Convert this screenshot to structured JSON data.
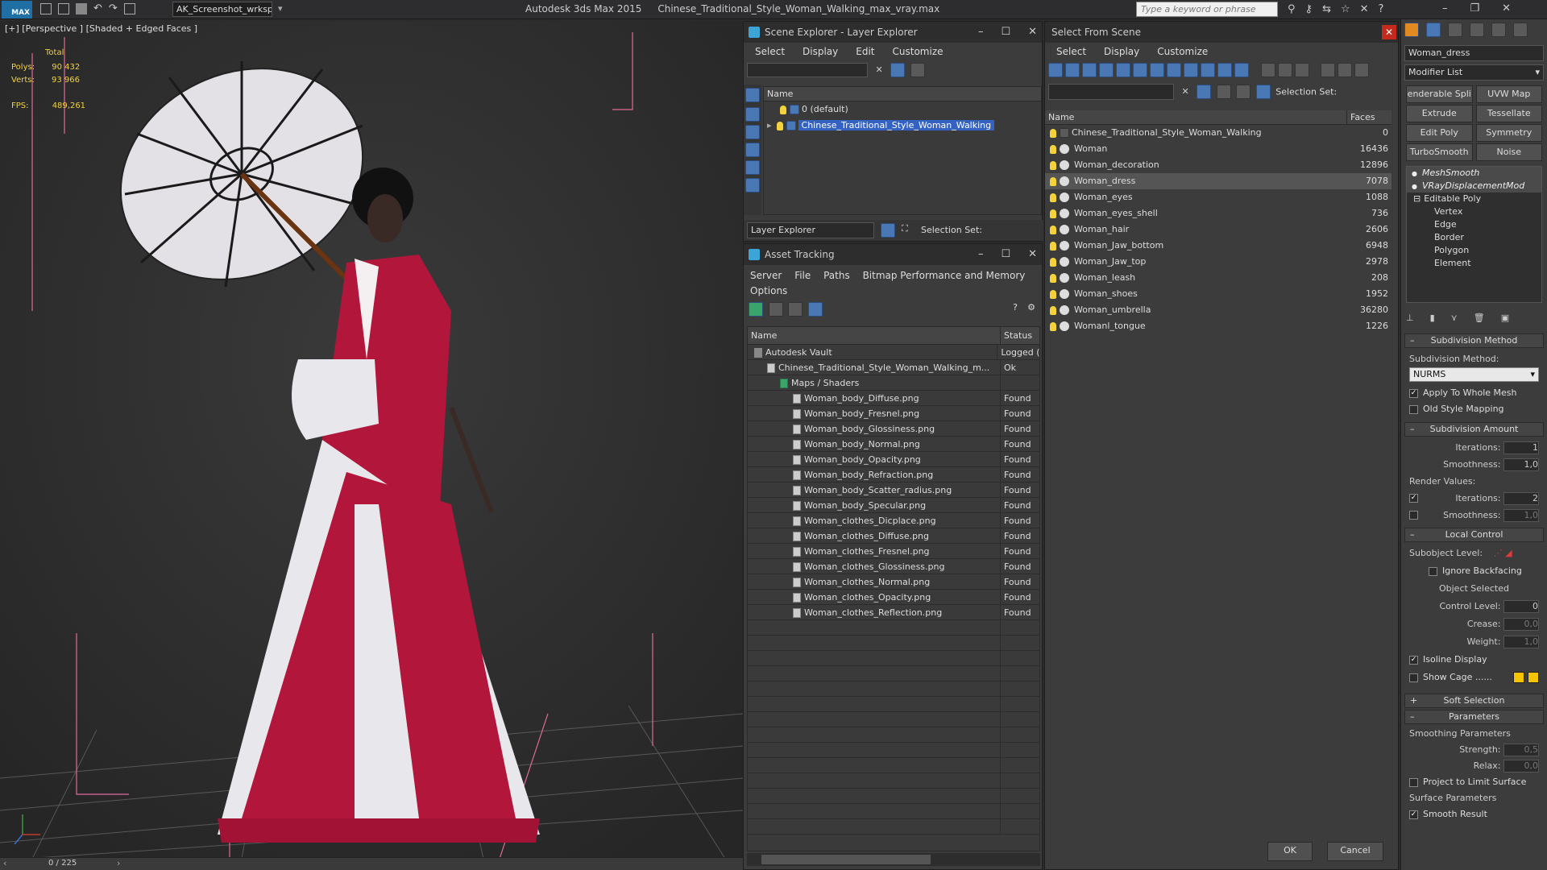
{
  "app": {
    "title": "Autodesk 3ds Max  2015",
    "file": "Chinese_Traditional_Style_Woman_Walking_max_vray.max",
    "workspace": "AK_Screenshot_wrksp",
    "search_placeholder": "Type a keyword or phrase",
    "logo": "MAX"
  },
  "viewport": {
    "label": "[+] [Perspective ] [Shaded + Edged Faces ]",
    "stats": {
      "total_label": "Total",
      "polys_label": "Polys:",
      "polys": "90 432",
      "verts_label": "Verts:",
      "verts": "93 966",
      "fps_label": "FPS:",
      "fps": "489,261"
    },
    "timeline": "0 / 225",
    "colors": {
      "dress_red": "#b2163b",
      "dress_white": "#e8e8ec",
      "grid": "#8a8a8a"
    }
  },
  "scene_explorer": {
    "title": "Scene Explorer - Layer Explorer",
    "menu": [
      "Select",
      "Display",
      "Edit",
      "Customize"
    ],
    "col_name": "Name",
    "layers": [
      {
        "name": "0 (default)"
      },
      {
        "name": "Chinese_Traditional_Style_Woman_Walking",
        "selected": true
      }
    ],
    "footer_dropdown": "Layer Explorer",
    "selection_set": "Selection Set:"
  },
  "asset_tracking": {
    "title": "Asset Tracking",
    "menu": [
      "Server",
      "File",
      "Paths",
      "Bitmap Performance and Memory"
    ],
    "menu2": "Options",
    "col_name": "Name",
    "col_status": "Status",
    "rows": [
      {
        "name": "Autodesk Vault",
        "status": "Logged (",
        "indent": 0
      },
      {
        "name": "Chinese_Traditional_Style_Woman_Walking_m...",
        "status": "Ok",
        "indent": 1
      },
      {
        "name": "Maps / Shaders",
        "status": "",
        "indent": 2
      },
      {
        "name": "Woman_body_Diffuse.png",
        "status": "Found",
        "indent": 3
      },
      {
        "name": "Woman_body_Fresnel.png",
        "status": "Found",
        "indent": 3
      },
      {
        "name": "Woman_body_Glossiness.png",
        "status": "Found",
        "indent": 3
      },
      {
        "name": "Woman_body_Normal.png",
        "status": "Found",
        "indent": 3
      },
      {
        "name": "Woman_body_Opacity.png",
        "status": "Found",
        "indent": 3
      },
      {
        "name": "Woman_body_Refraction.png",
        "status": "Found",
        "indent": 3
      },
      {
        "name": "Woman_body_Scatter_radius.png",
        "status": "Found",
        "indent": 3
      },
      {
        "name": "Woman_body_Specular.png",
        "status": "Found",
        "indent": 3
      },
      {
        "name": "Woman_clothes_Dicplace.png",
        "status": "Found",
        "indent": 3
      },
      {
        "name": "Woman_clothes_Diffuse.png",
        "status": "Found",
        "indent": 3
      },
      {
        "name": "Woman_clothes_Fresnel.png",
        "status": "Found",
        "indent": 3
      },
      {
        "name": "Woman_clothes_Glossiness.png",
        "status": "Found",
        "indent": 3
      },
      {
        "name": "Woman_clothes_Normal.png",
        "status": "Found",
        "indent": 3
      },
      {
        "name": "Woman_clothes_Opacity.png",
        "status": "Found",
        "indent": 3
      },
      {
        "name": "Woman_clothes_Reflection.png",
        "status": "Found",
        "indent": 3
      }
    ]
  },
  "select_from_scene": {
    "title": "Select From Scene",
    "menu": [
      "Select",
      "Display",
      "Customize"
    ],
    "selection_set": "Selection Set:",
    "col_name": "Name",
    "col_faces": "Faces",
    "rows": [
      {
        "name": "Chinese_Traditional_Style_Woman_Walking",
        "faces": "0"
      },
      {
        "name": "Woman",
        "faces": "16436"
      },
      {
        "name": "Woman_decoration",
        "faces": "12896"
      },
      {
        "name": "Woman_dress",
        "faces": "7078",
        "selected": true
      },
      {
        "name": "Woman_eyes",
        "faces": "1088"
      },
      {
        "name": "Woman_eyes_shell",
        "faces": "736"
      },
      {
        "name": "Woman_hair",
        "faces": "2606"
      },
      {
        "name": "Woman_Jaw_bottom",
        "faces": "6948"
      },
      {
        "name": "Woman_Jaw_top",
        "faces": "2978"
      },
      {
        "name": "Woman_leash",
        "faces": "208"
      },
      {
        "name": "Woman_shoes",
        "faces": "1952"
      },
      {
        "name": "Woman_umbrella",
        "faces": "36280"
      },
      {
        "name": "Womanl_tongue",
        "faces": "1226"
      }
    ],
    "ok": "OK",
    "cancel": "Cancel"
  },
  "command_panel": {
    "object_name": "Woman_dress",
    "modifier_list": "Modifier List",
    "buttons": [
      "enderable Spli",
      "UVW Map",
      "Extrude",
      "Tessellate",
      "Edit Poly",
      "Symmetry",
      "TurboSmooth",
      "Noise"
    ],
    "stack": [
      {
        "name": "MeshSmooth",
        "italic": true
      },
      {
        "name": "VRayDisplacementMod",
        "italic": true
      },
      {
        "name": "Editable Poly",
        "italic": false
      },
      {
        "name": "Vertex",
        "sub": true
      },
      {
        "name": "Edge",
        "sub": true
      },
      {
        "name": "Border",
        "sub": true
      },
      {
        "name": "Polygon",
        "sub": true
      },
      {
        "name": "Element",
        "sub": true
      }
    ],
    "subdivision_method": {
      "title": "Subdivision Method",
      "label": "Subdivision Method:",
      "value": "NURMS",
      "apply_whole": "Apply To Whole Mesh",
      "old_style": "Old Style Mapping"
    },
    "subdivision_amount": {
      "title": "Subdivision Amount",
      "iterations_label": "Iterations:",
      "iterations": "1",
      "smoothness_label": "Smoothness:",
      "smoothness": "1,0",
      "render_values": "Render Values:",
      "r_iterations_label": "Iterations:",
      "r_iterations": "2",
      "r_smoothness_label": "Smoothness:",
      "r_smoothness": "1,0"
    },
    "local_control": {
      "title": "Local Control",
      "subobject": "Subobject Level:",
      "ignore_backfacing": "Ignore Backfacing",
      "object_selected": "Object Selected",
      "control_level_label": "Control Level:",
      "control_level": "0",
      "crease_label": "Crease:",
      "crease": "0,0",
      "weight_label": "Weight:",
      "weight": "1,0",
      "isoline": "Isoline Display",
      "show_cage": "Show Cage ......"
    },
    "soft_selection": "Soft Selection",
    "parameters": {
      "title": "Parameters",
      "smoothing_params": "Smoothing Parameters",
      "strength_label": "Strength:",
      "strength": "0,5",
      "relax_label": "Relax:",
      "relax": "0,0",
      "project_limit": "Project to Limit Surface",
      "surface_params": "Surface Parameters",
      "smooth_result": "Smooth Result"
    },
    "cage_color": "#f5c400"
  }
}
